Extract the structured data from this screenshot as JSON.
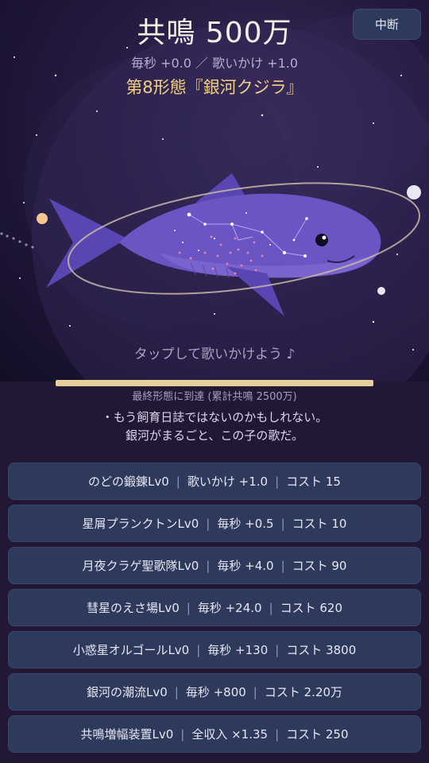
{
  "header": {
    "resonance_label": "共鳴",
    "resonance_value": "500万",
    "rates_text": "毎秒 +0.0 ／ 歌いかけ +1.0",
    "form_text": "第8形態『銀河クジラ』",
    "pause_label": "中断"
  },
  "scene": {
    "tap_hint": "タップして歌いかけよう ♪"
  },
  "progress": {
    "fraction": 1.0,
    "label": "最終形態に到達 (累計共鳴 2500万)"
  },
  "diary": {
    "line1": "・もう飼育日誌ではないのかもしれない。",
    "line2": "銀河がまるごと、この子の歌だ。"
  },
  "upgrades": [
    {
      "name": "のどの鍛錬",
      "level": "Lv0",
      "effect": "歌いかけ +1.0",
      "cost": "コスト 15"
    },
    {
      "name": "星屑プランクトン",
      "level": "Lv0",
      "effect": "毎秒 +0.5",
      "cost": "コスト 10"
    },
    {
      "name": "月夜クラゲ聖歌隊",
      "level": "Lv0",
      "effect": "毎秒 +4.0",
      "cost": "コスト 90"
    },
    {
      "name": "彗星のえさ場",
      "level": "Lv0",
      "effect": "毎秒 +24.0",
      "cost": "コスト 620"
    },
    {
      "name": "小惑星オルゴール",
      "level": "Lv0",
      "effect": "毎秒 +130",
      "cost": "コスト 3800"
    },
    {
      "name": "銀河の潮流",
      "level": "Lv0",
      "effect": "毎秒 +800",
      "cost": "コスト 2.20万"
    },
    {
      "name": "共鳴増幅装置",
      "level": "Lv0",
      "effect": "全収入 ×1.35",
      "cost": "コスト 250"
    }
  ],
  "colors": {
    "whale_body": "#6b55c4",
    "whale_fin": "#5a46b2",
    "accent_gold": "#f2cf82",
    "button_bg": "#2d3a5c"
  },
  "icons": {
    "planet_left": "planet-icon",
    "planet_right": "planet-icon",
    "whale": "galaxy-whale-icon"
  }
}
